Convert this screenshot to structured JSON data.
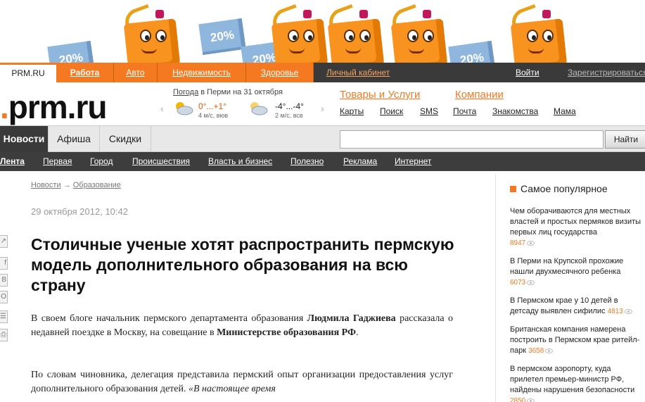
{
  "banner": {
    "tag_text": "20%"
  },
  "topnav": {
    "site": "PRM.RU",
    "items": [
      "Работа",
      "Авто",
      "Недвижимость",
      "Здоровье"
    ],
    "cabinet": "Личный кабинет",
    "login": "Войти",
    "register": "Зарегистрироваться"
  },
  "logo": {
    "dot": ".",
    "text": "prm.ru"
  },
  "weather": {
    "link": "Погода",
    "rest": " в Перми на 31 октября",
    "day": {
      "temp_a": "0°...",
      "temp_b": "+1°",
      "wind": "4 м/с, вюв"
    },
    "night": {
      "temp": "-4°...-4°",
      "wind": "2 м/с, всв"
    }
  },
  "services": {
    "goods": "Товары и Услуги",
    "companies": "Компании",
    "links": [
      "Карты",
      "Поиск",
      "SMS",
      "Почта",
      "Знакомства",
      "Мама"
    ]
  },
  "sections": {
    "tabs": [
      "Новости",
      "Афиша",
      "Скидки"
    ],
    "search_button": "Найти"
  },
  "subnav": {
    "items": [
      "Лента",
      "Первая",
      "Город",
      "Происшествия",
      "Власть и бизнес",
      "Полезно",
      "Реклама",
      "Интернет"
    ]
  },
  "share": {
    "icons": [
      "share-icon",
      "facebook-icon",
      "vkontakte-icon",
      "odnoklassniki-icon",
      "bookmark-icon",
      "print-icon"
    ],
    "glyphs": [
      "↗",
      "f",
      "В",
      "О",
      "☰",
      "⎙"
    ]
  },
  "article": {
    "breadcrumb": {
      "home": "Новости",
      "sep": "→",
      "section": "Образование"
    },
    "date": "29 октября 2012, 10:42",
    "title": "Столичные ученые хотят распространить пермскую модель дополнительного образования на всю страну",
    "p1_a": "В своем блоге начальник пермского департамента образования ",
    "p1_b": "Людмила Гаджиева",
    "p1_c": " рассказала о недавней поездке в Москву, на совещание в ",
    "p1_d": "Министерстве образования РФ",
    "p1_e": ".",
    "p2_a": "По словам чиновника, делегация представила  пермский опыт организации предоставления услуг дополнительного образования детей. ",
    "p2_b": "«В настоящее время"
  },
  "sidebar": {
    "heading": "Самое популярное",
    "items": [
      {
        "text": "Чем оборачиваются для местных властей и простых пермяков визиты первых лиц государства",
        "count": "8947"
      },
      {
        "text": "В Перми на Крупской прохожие нашли двухмесячного ребенка",
        "count": "6073"
      },
      {
        "text": "В Пермском крае у 10 детей в детсаду выявлен сифилис",
        "count": "4813"
      },
      {
        "text": "Британская компания намерена построить в Пермском крае ритейл-парк",
        "count": "3658"
      },
      {
        "text": "В пермском аэропорту, куда прилетел премьер-министр РФ, найдены нарушения безопасности",
        "count": "2850"
      }
    ]
  }
}
